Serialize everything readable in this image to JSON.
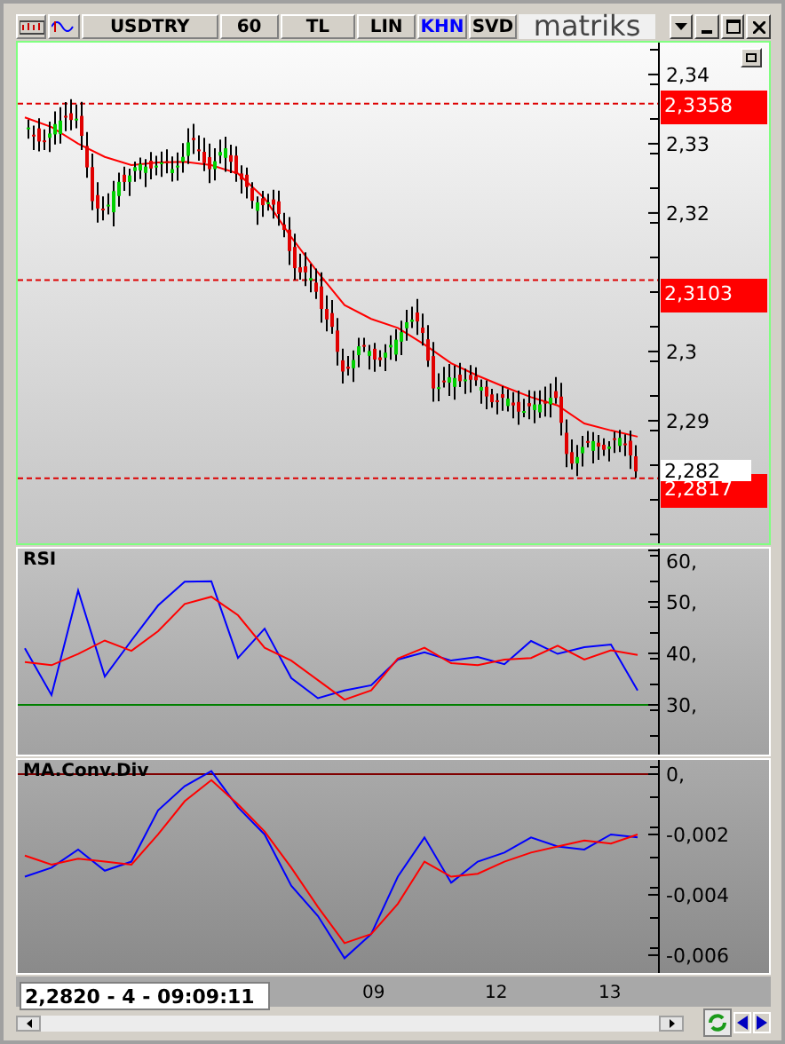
{
  "toolbar": {
    "items": [
      {
        "label": "USDTRY",
        "highlighted": false
      },
      {
        "label": "60",
        "highlighted": false
      },
      {
        "label": "TL",
        "highlighted": false
      },
      {
        "label": "LIN",
        "highlighted": false
      },
      {
        "label": "KHN",
        "highlighted": true
      },
      {
        "label": "SVD",
        "highlighted": false
      }
    ],
    "logo": "matriks"
  },
  "price_panel": {
    "chart_data": {
      "type": "line",
      "ylim": [
        2.2723,
        2.3446
      ],
      "yticks": [
        {
          "value": 2.34,
          "label": "2,34"
        },
        {
          "value": 2.33,
          "label": "2,33"
        },
        {
          "value": 2.32,
          "label": "2,32"
        },
        {
          "value": 2.3,
          "label": "2,3"
        },
        {
          "value": 2.29,
          "label": "2,29"
        }
      ],
      "ref_lines": [
        {
          "axis": "y",
          "value": 2.3358
        },
        {
          "axis": "y",
          "value": 2.3103
        },
        {
          "axis": "y",
          "value": 2.2817
        }
      ],
      "series": [
        {
          "color": "#ff0000",
          "values": [
            2.3338,
            2.3324,
            2.33,
            2.3281,
            2.3269,
            2.3273,
            2.3274,
            2.3269,
            2.3257,
            2.3221,
            2.3165,
            2.3114,
            2.3067,
            2.3047,
            2.3034,
            2.301,
            2.2983,
            2.2965,
            2.2949,
            2.2934,
            2.2922,
            2.2896,
            2.2886,
            2.2877
          ]
        }
      ]
    },
    "price_tags": [
      {
        "label": "2,3358",
        "kind": "level"
      },
      {
        "label": "2,3103",
        "kind": "level"
      },
      {
        "label": "2,282",
        "kind": "last"
      },
      {
        "label": "2,2817",
        "kind": "level"
      }
    ]
  },
  "indicators": [
    {
      "title": "RSI",
      "chart_data": {
        "type": "line",
        "ylim": [
          20.34,
          60.34
        ],
        "yticks": [
          {
            "value": 60,
            "label": "60,"
          },
          {
            "value": 50,
            "label": "50,"
          },
          {
            "value": 40,
            "label": "40,"
          },
          {
            "value": 30,
            "label": "30,"
          }
        ],
        "ref_lines": [
          {
            "axis": "y",
            "value": 30
          }
        ],
        "series": [
          {
            "color": "#0000ff",
            "values": [
              41.0,
              31.9,
              52.2,
              35.5,
              42.5,
              49.3,
              53.9,
              54.0,
              39.1,
              44.8,
              35.2,
              31.3,
              32.8,
              33.8,
              38.8,
              40.2,
              38.6,
              39.3,
              37.9,
              42.4,
              39.9,
              41.2,
              41.7,
              32.8
            ]
          },
          {
            "color": "#ff0000",
            "values": [
              38.3,
              37.7,
              39.9,
              42.5,
              40.5,
              44.3,
              49.6,
              51.0,
              47.4,
              41.1,
              38.6,
              34.8,
              31.0,
              32.8,
              39.0,
              41.1,
              38.1,
              37.7,
              38.8,
              39.1,
              41.5,
              38.8,
              40.6,
              39.7
            ]
          }
        ]
      }
    },
    {
      "title": "MA.Conv.Div",
      "chart_data": {
        "type": "line",
        "ylim": [
          -0.00659,
          0.00047
        ],
        "yticks": [
          {
            "value": 0,
            "label": "0,"
          },
          {
            "value": -0.002,
            "label": "-0,002"
          },
          {
            "value": -0.004,
            "label": "-0,004"
          },
          {
            "value": -0.006,
            "label": "-0,006"
          }
        ],
        "ref_lines": [
          {
            "axis": "y",
            "value": 0
          }
        ],
        "series": [
          {
            "color": "#0000ff",
            "values": [
              -0.0034,
              -0.0031,
              -0.0025,
              -0.0032,
              -0.0029,
              -0.0012,
              -0.0004,
              0.0001,
              -0.0011,
              -0.002,
              -0.0037,
              -0.0047,
              -0.0061,
              -0.0053,
              -0.0034,
              -0.0021,
              -0.0036,
              -0.0029,
              -0.0026,
              -0.0021,
              -0.0024,
              -0.0025,
              -0.002,
              -0.0021
            ]
          },
          {
            "color": "#ff0000",
            "values": [
              -0.0027,
              -0.003,
              -0.0028,
              -0.0029,
              -0.003,
              -0.002,
              -0.0009,
              -0.0002,
              -0.001,
              -0.0019,
              -0.0031,
              -0.0044,
              -0.0056,
              -0.0053,
              -0.0043,
              -0.0029,
              -0.0034,
              -0.0033,
              -0.0029,
              -0.0026,
              -0.0024,
              -0.0022,
              -0.0023,
              -0.002
            ]
          }
        ]
      }
    }
  ],
  "time_axis": {
    "labels": [
      "09",
      "12",
      "13"
    ]
  },
  "status": "2,2820 - 4 - 09:09:11"
}
